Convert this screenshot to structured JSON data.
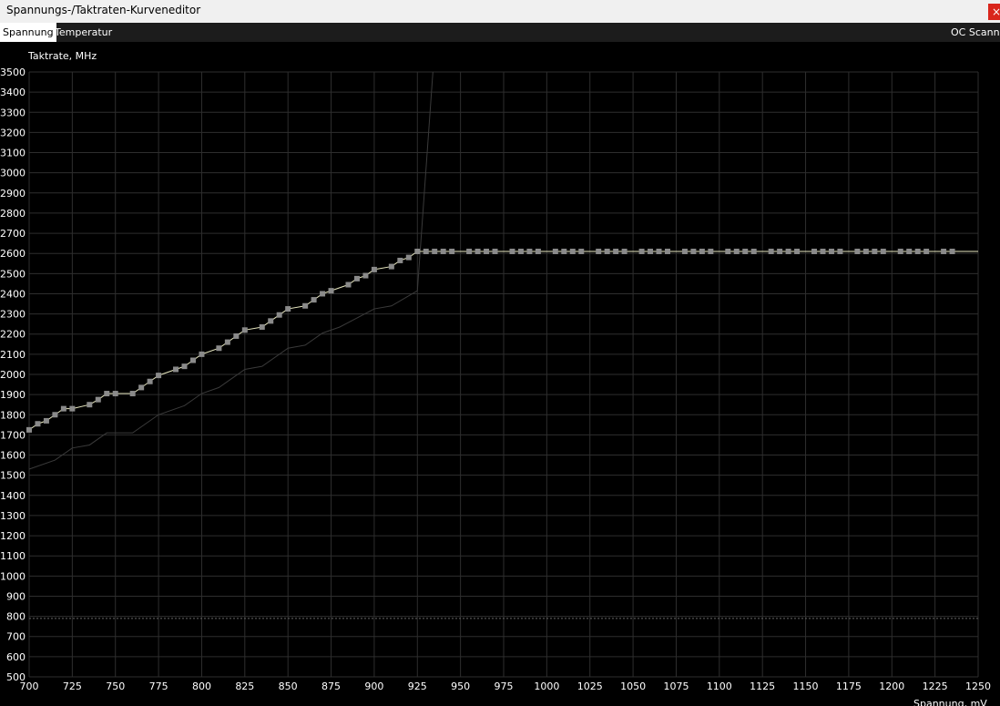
{
  "window": {
    "title": "Spannungs-/Taktraten-Kurveneditor",
    "close_glyph": "×"
  },
  "tabs": [
    {
      "label": "Spannung",
      "active": true
    },
    {
      "label": "Temperatur",
      "active": false
    }
  ],
  "toolbar": {
    "oc_scanner_label": "OC Scanne"
  },
  "colors": {
    "background": "#000000",
    "grid": "#2e2e2e",
    "curve": "#e8e8c0",
    "points": "#8a8a8a",
    "base_curve": "#3a3a3a",
    "dotted_line": "#666666",
    "tab_active": "#ffffff",
    "tab_bar": "#1c1c1c",
    "close": "#d9261c"
  },
  "chart_data": {
    "type": "line",
    "ylabel": "Taktrate, MHz",
    "xlabel": "Spannung, mV",
    "xlim": [
      700,
      1250
    ],
    "ylim": [
      500,
      3500
    ],
    "x_ticks": [
      700,
      725,
      750,
      775,
      800,
      825,
      850,
      875,
      900,
      925,
      950,
      975,
      1000,
      1025,
      1050,
      1075,
      1100,
      1125,
      1150,
      1175,
      1200,
      1225,
      1250
    ],
    "y_ticks": [
      500,
      600,
      700,
      800,
      900,
      1000,
      1100,
      1200,
      1300,
      1400,
      1500,
      1600,
      1700,
      1800,
      1900,
      2000,
      2100,
      2200,
      2300,
      2400,
      2500,
      2600,
      2700,
      2800,
      2900,
      3000,
      3100,
      3200,
      3300,
      3400,
      3500
    ],
    "grid": true,
    "dotted_line_y": 790,
    "series": [
      {
        "role": "curve-points",
        "x": [
          700,
          705,
          710,
          715,
          720,
          725,
          735,
          740,
          745,
          750,
          760,
          765,
          770,
          775,
          785,
          790,
          795,
          800,
          810,
          815,
          820,
          825,
          835,
          840,
          845,
          850,
          860,
          865,
          870,
          875,
          885,
          890,
          895,
          900,
          910,
          915,
          920,
          925,
          930,
          935,
          940,
          945,
          955,
          960,
          965,
          970,
          980,
          985,
          990,
          995,
          1005,
          1010,
          1015,
          1020,
          1030,
          1035,
          1040,
          1045,
          1055,
          1060,
          1065,
          1070,
          1080,
          1085,
          1090,
          1095,
          1105,
          1110,
          1115,
          1120,
          1130,
          1135,
          1140,
          1145,
          1155,
          1160,
          1165,
          1170,
          1180,
          1185,
          1190,
          1195,
          1205,
          1210,
          1215,
          1220,
          1230,
          1235
        ],
        "y": [
          1725,
          1755,
          1770,
          1800,
          1830,
          1830,
          1850,
          1875,
          1905,
          1905,
          1905,
          1935,
          1965,
          1995,
          2025,
          2040,
          2070,
          2100,
          2130,
          2160,
          2190,
          2220,
          2235,
          2265,
          2295,
          2325,
          2340,
          2370,
          2400,
          2415,
          2445,
          2475,
          2490,
          2520,
          2535,
          2565,
          2580,
          2610,
          2610,
          2610,
          2610,
          2610,
          2610,
          2610,
          2610,
          2610,
          2610,
          2610,
          2610,
          2610,
          2610,
          2610,
          2610,
          2610,
          2610,
          2610,
          2610,
          2610,
          2610,
          2610,
          2610,
          2610,
          2610,
          2610,
          2610,
          2610,
          2610,
          2610,
          2610,
          2610,
          2610,
          2610,
          2610,
          2610,
          2610,
          2610,
          2610,
          2610,
          2610,
          2610,
          2610,
          2610,
          2610,
          2610,
          2610,
          2610,
          2610,
          2610
        ]
      },
      {
        "role": "curve-end",
        "x": [
          1235,
          1250
        ],
        "y": [
          2610,
          2610
        ]
      },
      {
        "role": "base-curve",
        "x": [
          700,
          715,
          725,
          735,
          745,
          760,
          775,
          790,
          800,
          810,
          825,
          835,
          850,
          860,
          870,
          880,
          890,
          900,
          910,
          925,
          934
        ],
        "y": [
          1530,
          1575,
          1635,
          1650,
          1710,
          1710,
          1800,
          1845,
          1905,
          1935,
          2025,
          2040,
          2130,
          2145,
          2205,
          2235,
          2280,
          2325,
          2340,
          2415,
          3500
        ]
      }
    ]
  }
}
